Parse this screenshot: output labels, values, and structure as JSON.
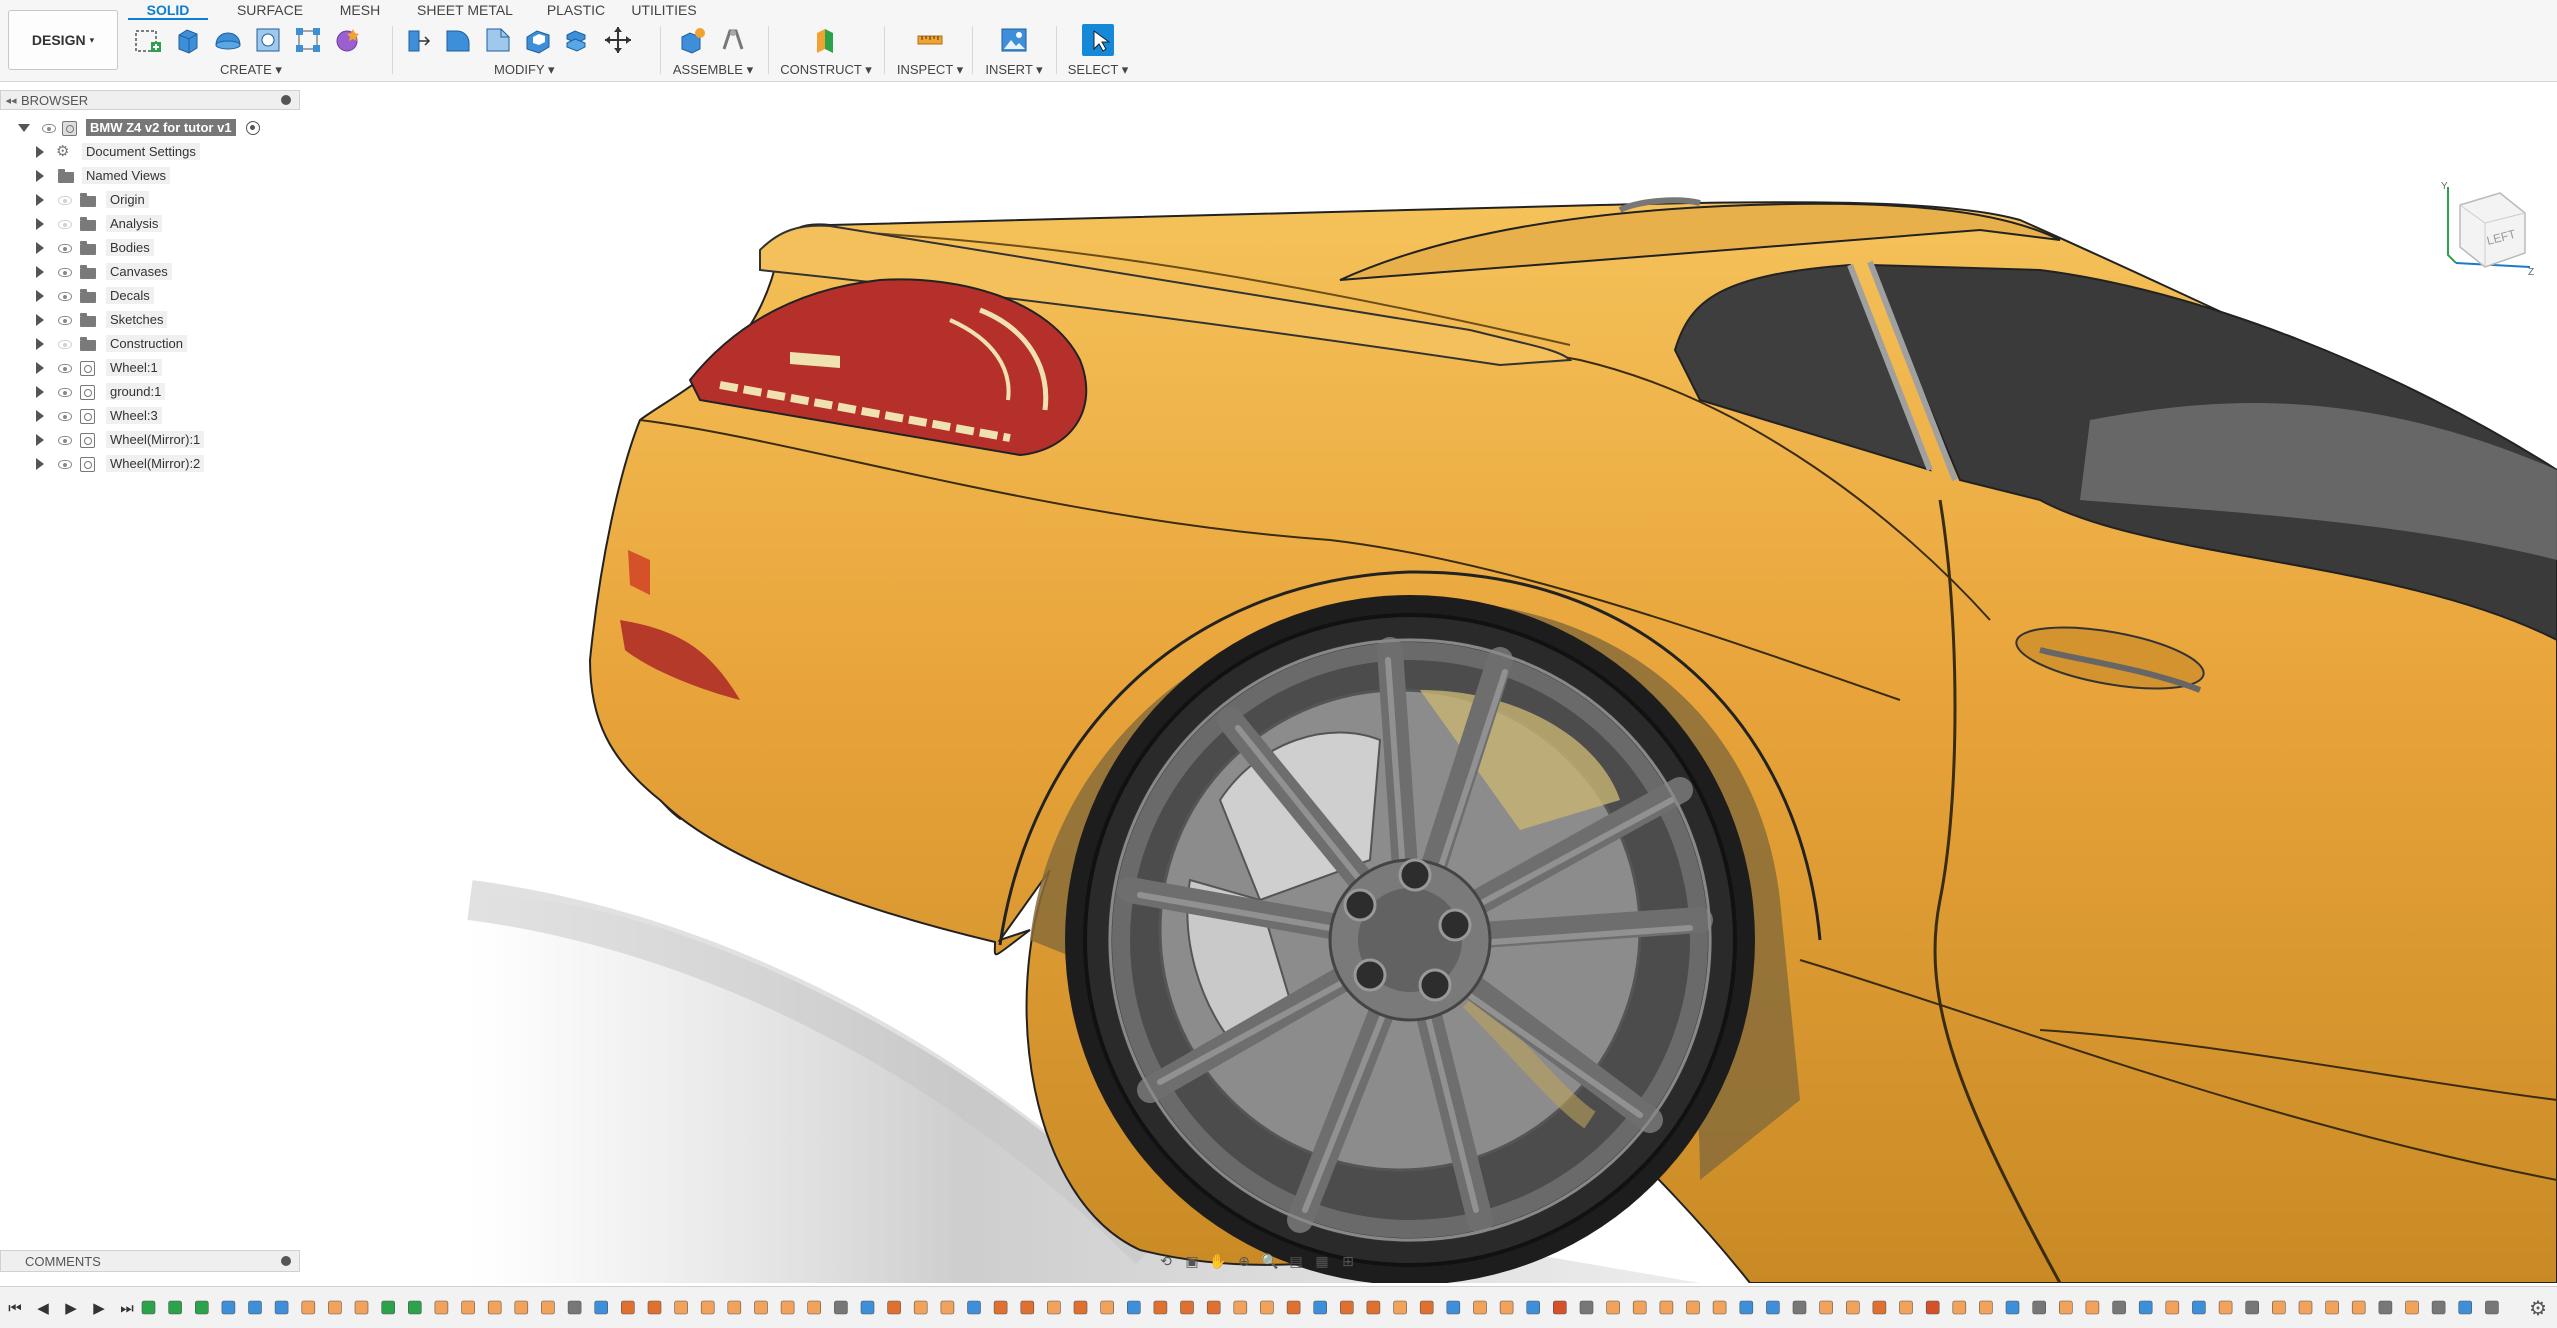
{
  "toolbar": {
    "workspace": "DESIGN",
    "tabs": [
      {
        "label": "SOLID",
        "active": true
      },
      {
        "label": "SURFACE",
        "active": false
      },
      {
        "label": "MESH",
        "active": false
      },
      {
        "label": "SHEET METAL",
        "active": false
      },
      {
        "label": "PLASTIC",
        "active": false
      },
      {
        "label": "UTILITIES",
        "active": false
      }
    ],
    "groups": {
      "create": "CREATE",
      "modify": "MODIFY",
      "assemble": "ASSEMBLE",
      "construct": "CONSTRUCT",
      "inspect": "INSPECT",
      "insert": "INSERT",
      "select": "SELECT"
    }
  },
  "browser": {
    "title": "BROWSER",
    "root": "BMW Z4 v2 for tutor v1",
    "items": [
      {
        "label": "Document Settings",
        "icon": "gear-icon",
        "eye": false
      },
      {
        "label": "Named Views",
        "icon": "folder-icon",
        "eye": false
      },
      {
        "label": "Origin",
        "icon": "folder-icon",
        "eye": true,
        "dim": true
      },
      {
        "label": "Analysis",
        "icon": "folder-icon",
        "eye": true,
        "dim": true
      },
      {
        "label": "Bodies",
        "icon": "folder-icon",
        "eye": true,
        "dim": false
      },
      {
        "label": "Canvases",
        "icon": "folder-icon",
        "eye": true,
        "dim": false
      },
      {
        "label": "Decals",
        "icon": "folder-icon",
        "eye": true,
        "dim": false
      },
      {
        "label": "Sketches",
        "icon": "folder-icon",
        "eye": true,
        "dim": false
      },
      {
        "label": "Construction",
        "icon": "folder-icon",
        "eye": true,
        "dim": true
      },
      {
        "label": "Wheel:1",
        "icon": "component-icon",
        "eye": true,
        "dim": false
      },
      {
        "label": "ground:1",
        "icon": "component-icon",
        "eye": true,
        "dim": false
      },
      {
        "label": "Wheel:3",
        "icon": "component-icon",
        "eye": true,
        "dim": false
      },
      {
        "label": "Wheel(Mirror):1",
        "icon": "component-icon",
        "eye": true,
        "dim": false
      },
      {
        "label": "Wheel(Mirror):2",
        "icon": "component-icon",
        "eye": true,
        "dim": false
      }
    ]
  },
  "comments": {
    "title": "COMMENTS"
  },
  "viewcube": {
    "face": "LEFT",
    "axis_y": "Y",
    "axis_z": "Z"
  },
  "colors": {
    "car_body": "#e8a43a",
    "tail_light": "#b5302a",
    "window": "#3e3e3e",
    "rim": "#707070",
    "tire": "#1d1d1d",
    "accent": "#0d7ed0"
  }
}
